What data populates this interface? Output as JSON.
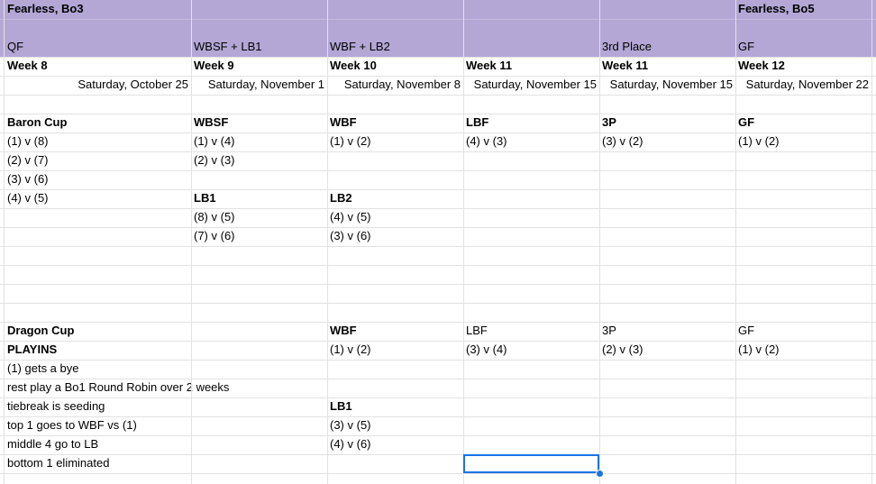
{
  "header": {
    "format_bo3": "Fearless, Bo3",
    "format_bo5": "Fearless, Bo5",
    "stages": [
      "QF",
      "WBSF + LB1",
      "WBF + LB2",
      "",
      "3rd Place",
      "GF"
    ],
    "weeks": [
      "Week 8",
      "Week 9",
      "Week 10",
      "Week 11",
      "Week 11",
      "Week 12"
    ],
    "dates": [
      "Saturday, October 25",
      "Saturday, November 1",
      "Saturday, November 8",
      "Saturday, November 15",
      "Saturday, November 15",
      "Saturday, November 22"
    ]
  },
  "baron": {
    "title": "Baron Cup",
    "heads": [
      "",
      "WBSF",
      "WBF",
      "LBF",
      "3P",
      "GF"
    ],
    "qf": [
      "(1) v (8)",
      "(2) v (7)",
      "(3) v (6)",
      "(4) v (5)"
    ],
    "wbsf": [
      "(1) v (4)",
      "(2) v (3)"
    ],
    "wbf": "(1) v (2)",
    "lbf": "(4) v (3)",
    "tp": "(3) v (2)",
    "gf": "(1) v (2)",
    "lb1_title": "LB1",
    "lb1": [
      "(8) v (5)",
      "(7) v (6)"
    ],
    "lb2_title": "LB2",
    "lb2": [
      "(4) v (5)",
      "(3) v (6)"
    ]
  },
  "dragon": {
    "title": "Dragon Cup",
    "heads": [
      "WBF",
      "LBF",
      "3P",
      "GF"
    ],
    "playins": "PLAYINS",
    "wbf": "(1) v (2)",
    "lbf": "(3) v (4)",
    "tp": "(2) v (3)",
    "gf": "(1) v (2)",
    "notes": [
      "(1) gets a bye",
      "rest play a Bo1 Round Robin over 2 weeks",
      "tiebreak is seeding",
      "top 1 goes to WBF vs (1)",
      "middle 4 go to LB",
      "bottom 1 eliminated"
    ],
    "lb1_title": "LB1",
    "lb1": [
      "(3) v (5)",
      "(4) v (6)"
    ]
  },
  "colors": {
    "header_bg": "#b4a7d6",
    "selection": "#1a73e8",
    "grid": "#e2e2e2"
  }
}
